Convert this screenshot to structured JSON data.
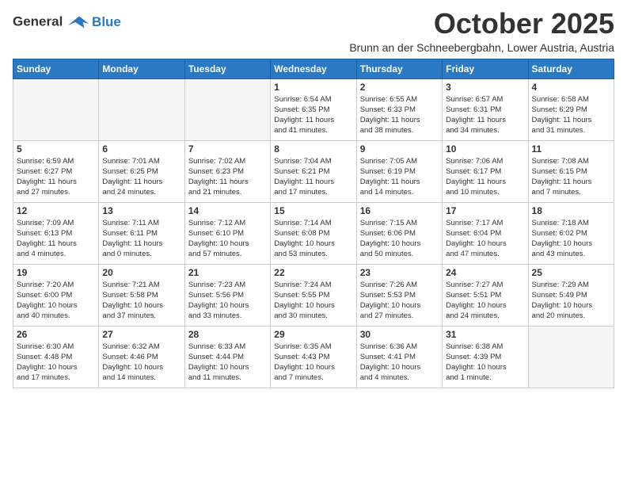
{
  "logo": {
    "line1": "General",
    "line2": "Blue"
  },
  "title": "October 2025",
  "subtitle": "Brunn an der Schneebergbahn, Lower Austria, Austria",
  "days_of_week": [
    "Sunday",
    "Monday",
    "Tuesday",
    "Wednesday",
    "Thursday",
    "Friday",
    "Saturday"
  ],
  "weeks": [
    [
      {
        "day": "",
        "info": ""
      },
      {
        "day": "",
        "info": ""
      },
      {
        "day": "",
        "info": ""
      },
      {
        "day": "1",
        "info": "Sunrise: 6:54 AM\nSunset: 6:35 PM\nDaylight: 11 hours\nand 41 minutes."
      },
      {
        "day": "2",
        "info": "Sunrise: 6:55 AM\nSunset: 6:33 PM\nDaylight: 11 hours\nand 38 minutes."
      },
      {
        "day": "3",
        "info": "Sunrise: 6:57 AM\nSunset: 6:31 PM\nDaylight: 11 hours\nand 34 minutes."
      },
      {
        "day": "4",
        "info": "Sunrise: 6:58 AM\nSunset: 6:29 PM\nDaylight: 11 hours\nand 31 minutes."
      }
    ],
    [
      {
        "day": "5",
        "info": "Sunrise: 6:59 AM\nSunset: 6:27 PM\nDaylight: 11 hours\nand 27 minutes."
      },
      {
        "day": "6",
        "info": "Sunrise: 7:01 AM\nSunset: 6:25 PM\nDaylight: 11 hours\nand 24 minutes."
      },
      {
        "day": "7",
        "info": "Sunrise: 7:02 AM\nSunset: 6:23 PM\nDaylight: 11 hours\nand 21 minutes."
      },
      {
        "day": "8",
        "info": "Sunrise: 7:04 AM\nSunset: 6:21 PM\nDaylight: 11 hours\nand 17 minutes."
      },
      {
        "day": "9",
        "info": "Sunrise: 7:05 AM\nSunset: 6:19 PM\nDaylight: 11 hours\nand 14 minutes."
      },
      {
        "day": "10",
        "info": "Sunrise: 7:06 AM\nSunset: 6:17 PM\nDaylight: 11 hours\nand 10 minutes."
      },
      {
        "day": "11",
        "info": "Sunrise: 7:08 AM\nSunset: 6:15 PM\nDaylight: 11 hours\nand 7 minutes."
      }
    ],
    [
      {
        "day": "12",
        "info": "Sunrise: 7:09 AM\nSunset: 6:13 PM\nDaylight: 11 hours\nand 4 minutes."
      },
      {
        "day": "13",
        "info": "Sunrise: 7:11 AM\nSunset: 6:11 PM\nDaylight: 11 hours\nand 0 minutes."
      },
      {
        "day": "14",
        "info": "Sunrise: 7:12 AM\nSunset: 6:10 PM\nDaylight: 10 hours\nand 57 minutes."
      },
      {
        "day": "15",
        "info": "Sunrise: 7:14 AM\nSunset: 6:08 PM\nDaylight: 10 hours\nand 53 minutes."
      },
      {
        "day": "16",
        "info": "Sunrise: 7:15 AM\nSunset: 6:06 PM\nDaylight: 10 hours\nand 50 minutes."
      },
      {
        "day": "17",
        "info": "Sunrise: 7:17 AM\nSunset: 6:04 PM\nDaylight: 10 hours\nand 47 minutes."
      },
      {
        "day": "18",
        "info": "Sunrise: 7:18 AM\nSunset: 6:02 PM\nDaylight: 10 hours\nand 43 minutes."
      }
    ],
    [
      {
        "day": "19",
        "info": "Sunrise: 7:20 AM\nSunset: 6:00 PM\nDaylight: 10 hours\nand 40 minutes."
      },
      {
        "day": "20",
        "info": "Sunrise: 7:21 AM\nSunset: 5:58 PM\nDaylight: 10 hours\nand 37 minutes."
      },
      {
        "day": "21",
        "info": "Sunrise: 7:23 AM\nSunset: 5:56 PM\nDaylight: 10 hours\nand 33 minutes."
      },
      {
        "day": "22",
        "info": "Sunrise: 7:24 AM\nSunset: 5:55 PM\nDaylight: 10 hours\nand 30 minutes."
      },
      {
        "day": "23",
        "info": "Sunrise: 7:26 AM\nSunset: 5:53 PM\nDaylight: 10 hours\nand 27 minutes."
      },
      {
        "day": "24",
        "info": "Sunrise: 7:27 AM\nSunset: 5:51 PM\nDaylight: 10 hours\nand 24 minutes."
      },
      {
        "day": "25",
        "info": "Sunrise: 7:29 AM\nSunset: 5:49 PM\nDaylight: 10 hours\nand 20 minutes."
      }
    ],
    [
      {
        "day": "26",
        "info": "Sunrise: 6:30 AM\nSunset: 4:48 PM\nDaylight: 10 hours\nand 17 minutes."
      },
      {
        "day": "27",
        "info": "Sunrise: 6:32 AM\nSunset: 4:46 PM\nDaylight: 10 hours\nand 14 minutes."
      },
      {
        "day": "28",
        "info": "Sunrise: 6:33 AM\nSunset: 4:44 PM\nDaylight: 10 hours\nand 11 minutes."
      },
      {
        "day": "29",
        "info": "Sunrise: 6:35 AM\nSunset: 4:43 PM\nDaylight: 10 hours\nand 7 minutes."
      },
      {
        "day": "30",
        "info": "Sunrise: 6:36 AM\nSunset: 4:41 PM\nDaylight: 10 hours\nand 4 minutes."
      },
      {
        "day": "31",
        "info": "Sunrise: 6:38 AM\nSunset: 4:39 PM\nDaylight: 10 hours\nand 1 minute."
      },
      {
        "day": "",
        "info": ""
      }
    ]
  ]
}
